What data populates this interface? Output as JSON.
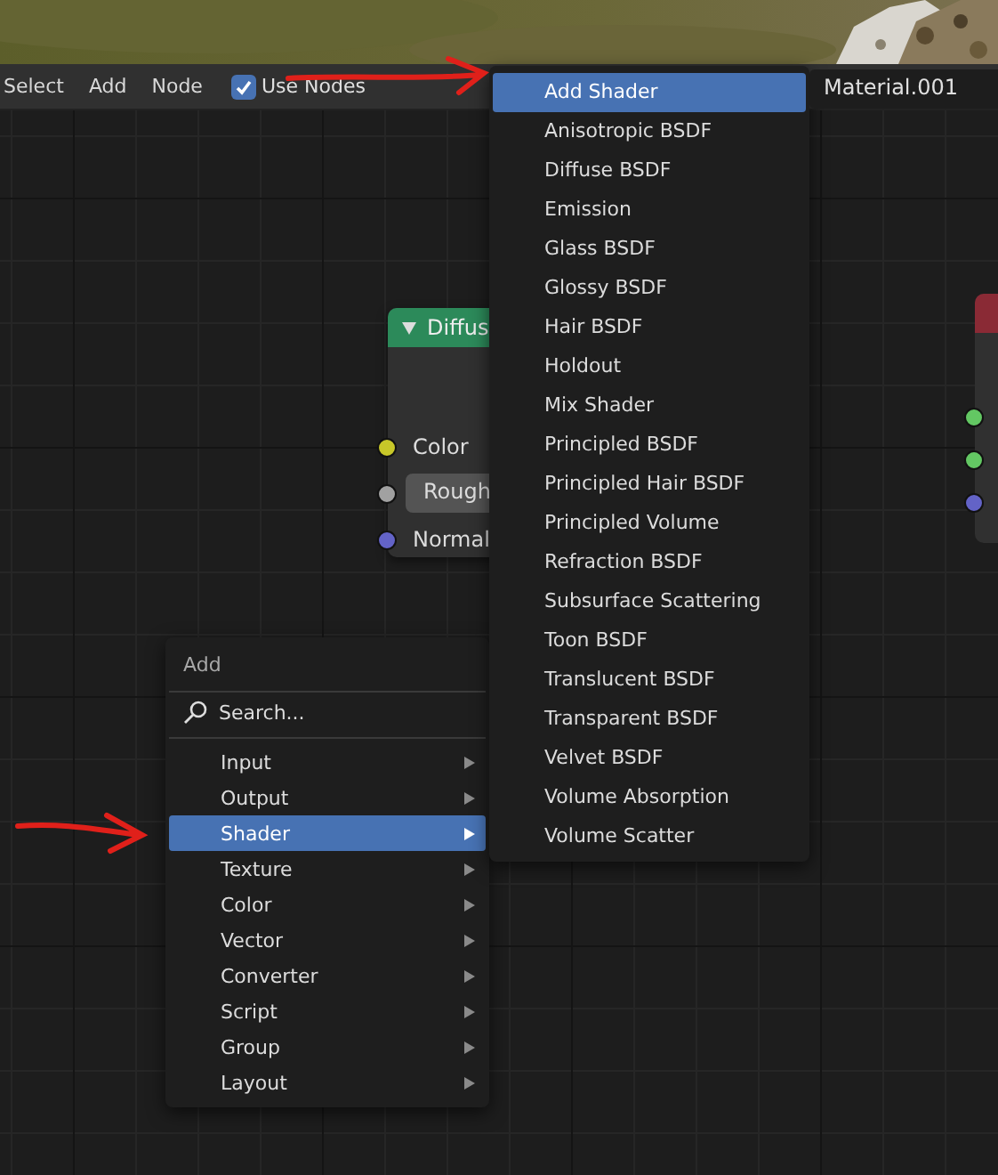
{
  "header": {
    "menus": [
      "Select",
      "Add",
      "Node"
    ],
    "use_nodes": {
      "label": "Use Nodes",
      "checked": true
    },
    "material": {
      "value": "Material.001"
    }
  },
  "node": {
    "title": "Diffus",
    "sockets": [
      {
        "kind": "label",
        "label": "Color",
        "color": "#c7c729"
      },
      {
        "kind": "field",
        "label": "Rough",
        "color": "#a1a1a1"
      },
      {
        "kind": "label",
        "label": "Normal",
        "color": "#6363c7"
      }
    ]
  },
  "side_node": {
    "sockets": [
      {
        "color": "#63c763"
      },
      {
        "color": "#63c763"
      },
      {
        "color": "#6363c7"
      }
    ]
  },
  "add_menu": {
    "title": "Add",
    "search": {
      "placeholder": "Search..."
    },
    "items": [
      {
        "label": "Input",
        "selected": false
      },
      {
        "label": "Output",
        "selected": false
      },
      {
        "label": "Shader",
        "selected": true
      },
      {
        "label": "Texture",
        "selected": false
      },
      {
        "label": "Color",
        "selected": false
      },
      {
        "label": "Vector",
        "selected": false
      },
      {
        "label": "Converter",
        "selected": false
      },
      {
        "label": "Script",
        "selected": false
      },
      {
        "label": "Group",
        "selected": false
      },
      {
        "label": "Layout",
        "selected": false
      }
    ]
  },
  "shader_menu": {
    "items": [
      {
        "label": "Add Shader",
        "selected": true
      },
      {
        "label": "Anisotropic BSDF",
        "selected": false
      },
      {
        "label": "Diffuse BSDF",
        "selected": false
      },
      {
        "label": "Emission",
        "selected": false
      },
      {
        "label": "Glass BSDF",
        "selected": false
      },
      {
        "label": "Glossy BSDF",
        "selected": false
      },
      {
        "label": "Hair BSDF",
        "selected": false
      },
      {
        "label": "Holdout",
        "selected": false
      },
      {
        "label": "Mix Shader",
        "selected": false
      },
      {
        "label": "Principled BSDF",
        "selected": false
      },
      {
        "label": "Principled Hair BSDF",
        "selected": false
      },
      {
        "label": "Principled Volume",
        "selected": false
      },
      {
        "label": "Refraction BSDF",
        "selected": false
      },
      {
        "label": "Subsurface Scattering",
        "selected": false
      },
      {
        "label": "Toon BSDF",
        "selected": false
      },
      {
        "label": "Translucent BSDF",
        "selected": false
      },
      {
        "label": "Transparent BSDF",
        "selected": false
      },
      {
        "label": "Velvet BSDF",
        "selected": false
      },
      {
        "label": "Volume Absorption",
        "selected": false
      },
      {
        "label": "Volume Scatter",
        "selected": false
      }
    ]
  }
}
